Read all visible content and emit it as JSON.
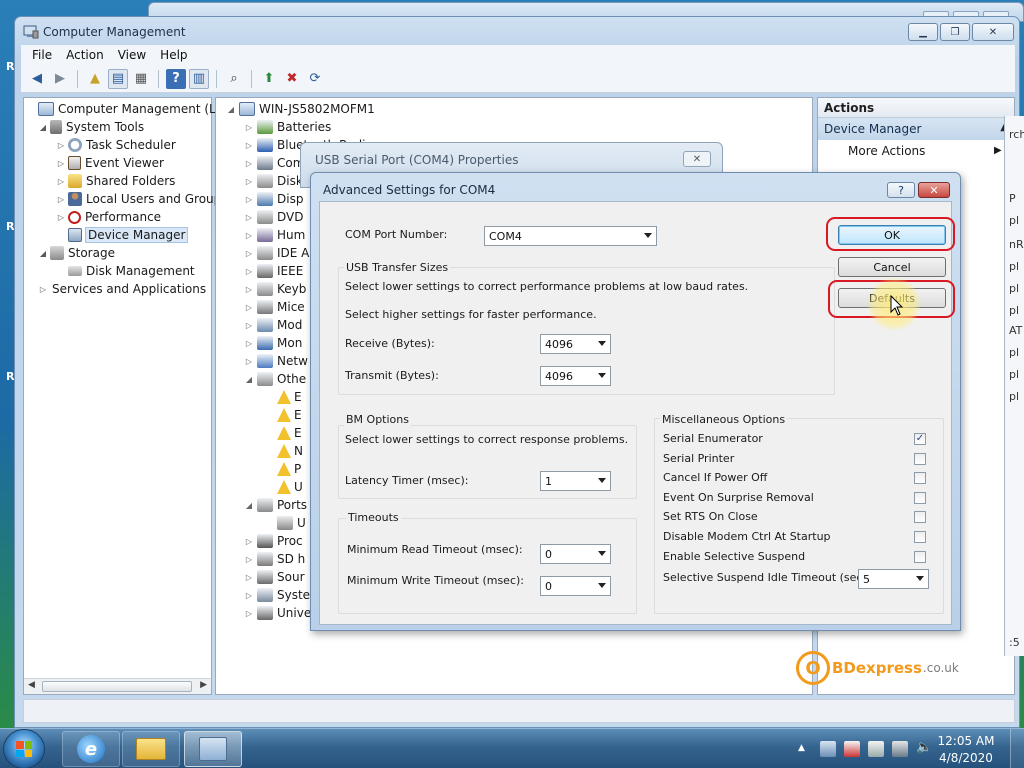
{
  "mmc": {
    "title": "Computer Management",
    "menu": [
      "File",
      "Action",
      "View",
      "Help"
    ]
  },
  "tree": {
    "items": [
      {
        "label": "Computer Management (Local",
        "level": 0
      },
      {
        "label": "System Tools",
        "level": 1
      },
      {
        "label": "Task Scheduler",
        "level": 2
      },
      {
        "label": "Event Viewer",
        "level": 2
      },
      {
        "label": "Shared Folders",
        "level": 2
      },
      {
        "label": "Local Users and Groups",
        "level": 2
      },
      {
        "label": "Performance",
        "level": 2
      },
      {
        "label": "Device Manager",
        "level": 2,
        "selected": true
      },
      {
        "label": "Storage",
        "level": 1
      },
      {
        "label": "Disk Management",
        "level": 2
      },
      {
        "label": "Services and Applications",
        "level": 1
      }
    ]
  },
  "devices": {
    "root": "WIN-JS5802MOFM1",
    "items": [
      "Batteries",
      "Bluetooth Radios",
      "Com",
      "Disk",
      "Disp",
      "DVD",
      "Hum",
      "IDE A",
      "IEEE",
      "Keyb",
      "Mice",
      "Mod",
      "Mon",
      "Netw",
      "Othe",
      "Ports",
      "Proc",
      "SD h",
      "Sour",
      "Syste",
      "Univer"
    ],
    "other_children": [
      "E",
      "E",
      "E",
      "N",
      "P",
      "U"
    ],
    "ports_children": [
      "U"
    ]
  },
  "actions": {
    "header": "Actions",
    "section": "Device Manager",
    "more": "More Actions"
  },
  "props_dialog": {
    "title": "USB Serial Port (COM4) Properties"
  },
  "adv_dialog": {
    "title": "Advanced Settings for COM4",
    "help": "?",
    "close": "✕",
    "com_port_label": "COM Port Number:",
    "com_port_value": "COM4",
    "usb_group": "USB Transfer Sizes",
    "usb_line1": "Select lower settings to correct performance problems at low baud rates.",
    "usb_line2": "Select higher settings for faster performance.",
    "receive_label": "Receive (Bytes):",
    "receive_value": "4096",
    "transmit_label": "Transmit (Bytes):",
    "transmit_value": "4096",
    "bm_group": "BM Options",
    "bm_line": "Select lower settings to correct response problems.",
    "latency_label": "Latency Timer (msec):",
    "latency_value": "1",
    "timeouts_group": "Timeouts",
    "min_read_label": "Minimum Read Timeout (msec):",
    "min_read_value": "0",
    "min_write_label": "Minimum Write Timeout (msec):",
    "min_write_value": "0",
    "misc_group": "Miscellaneous Options",
    "misc_options": [
      {
        "label": "Serial Enumerator",
        "checked": true
      },
      {
        "label": "Serial Printer",
        "checked": false
      },
      {
        "label": "Cancel If Power Off",
        "checked": false
      },
      {
        "label": "Event On Surprise Removal",
        "checked": false
      },
      {
        "label": "Set RTS On Close",
        "checked": false
      },
      {
        "label": "Disable Modem Ctrl At Startup",
        "checked": false
      },
      {
        "label": "Enable Selective Suspend",
        "checked": false
      }
    ],
    "suspend_label": "Selective Suspend Idle Timeout (secs):",
    "suspend_value": "5",
    "ok": "OK",
    "cancel": "Cancel",
    "defaults": "Defaults"
  },
  "watermark": {
    "o": "O",
    "text": "BDexpress",
    "suffix": ".co.uk"
  },
  "taskbar": {
    "time": "12:05 AM",
    "date": "4/8/2020"
  },
  "sliver": {
    "lines": [
      "rch",
      "P",
      "pl",
      "nR",
      "pl",
      "pl",
      "pl",
      "AT",
      "pl",
      "pl",
      "pl",
      ":5"
    ]
  },
  "desktop_letters": [
    "R",
    "R",
    "R"
  ]
}
